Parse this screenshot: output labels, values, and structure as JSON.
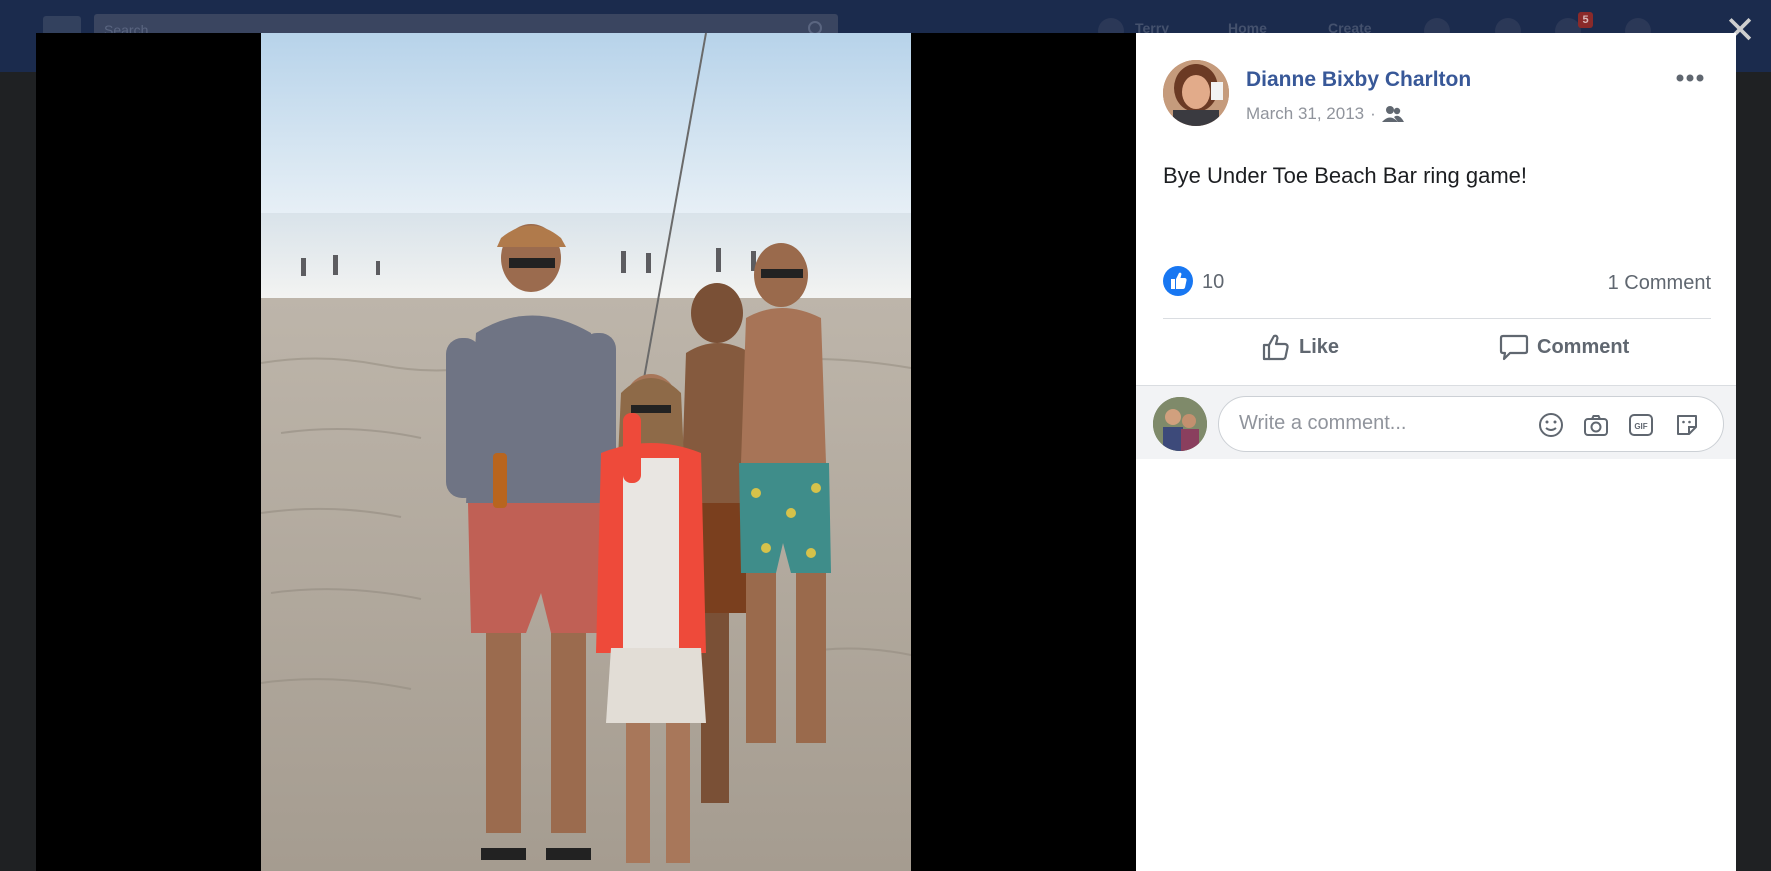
{
  "topbar": {
    "search_placeholder": "Search",
    "nav_items": [
      "Terry",
      "Home",
      "Create"
    ],
    "notifications_count": "5"
  },
  "post": {
    "author": "Dianne Bixby Charlton",
    "date": "March 31, 2013",
    "separator": "·",
    "text": "Bye Under Toe Beach Bar ring game!",
    "reaction_count": "10",
    "comment_count": "1 Comment",
    "like_label": "Like",
    "comment_label": "Comment"
  },
  "composer": {
    "placeholder": "Write a comment..."
  },
  "icons": {
    "close": "close-icon",
    "more": "more-options-icon",
    "audience": "friends-icon",
    "like": "thumbs-up-icon",
    "comment": "speech-bubble-icon",
    "emoji": "emoji-icon",
    "camera": "camera-icon",
    "gif": "gif-icon",
    "sticker": "sticker-icon"
  },
  "colors": {
    "brand": "#385898",
    "like_blue": "#1877f2",
    "theater_bg": "#000000"
  }
}
